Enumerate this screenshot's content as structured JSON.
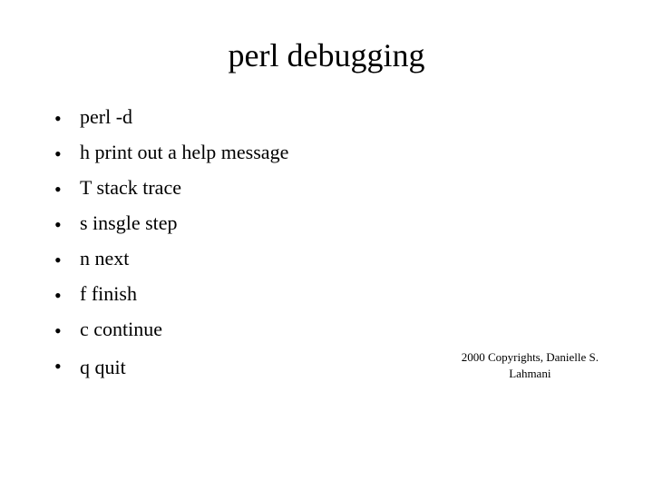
{
  "title": "perl debugging",
  "bullets": [
    {
      "key": "perl -d",
      "desc": ""
    },
    {
      "key": "h",
      "desc": "print out a help message"
    },
    {
      "key": "T",
      "desc": "stack trace"
    },
    {
      "key": "s",
      "desc": "insgle step"
    },
    {
      "key": "n",
      "desc": "next"
    },
    {
      "key": "f",
      "desc": " finish"
    },
    {
      "key": "c",
      "desc": "continue"
    },
    {
      "key": "q",
      "desc": "quit"
    }
  ],
  "copyright_line1": "2000 Copyrights, Danielle S.",
  "copyright_line2": "Lahmani"
}
